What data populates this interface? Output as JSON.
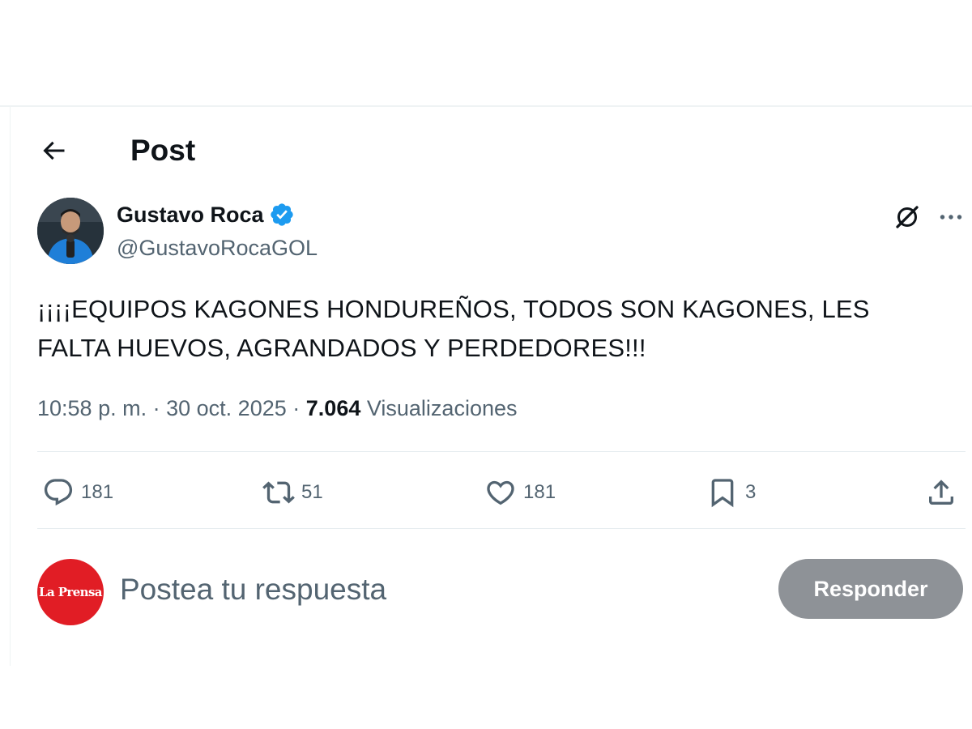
{
  "header": {
    "back_icon": "arrow-left-icon",
    "title": "Post"
  },
  "tweet": {
    "author": {
      "name": "Gustavo Roca",
      "handle": "@GustavoRocaGOL",
      "verified": true,
      "verified_color": "#1d9bf0"
    },
    "text": "¡¡¡¡EQUIPOS KAGONES HONDUREÑOS, TODOS SON KAGONES, LES FALTA HUEVOS, AGRANDADOS Y PERDEDORES!!!",
    "time": "10:58 p. m.",
    "date": "30 oct. 2025",
    "views_count": "7.064",
    "views_label": "Visualizaciones",
    "separator": "·"
  },
  "actions": {
    "replies": "181",
    "reposts": "51",
    "likes": "181",
    "bookmarks": "3"
  },
  "reply_box": {
    "avatar_text": "La Prensa",
    "avatar_color": "#e11d25",
    "placeholder": "Postea tu respuesta",
    "button_label": "Responder",
    "button_color": "#8e9297"
  }
}
